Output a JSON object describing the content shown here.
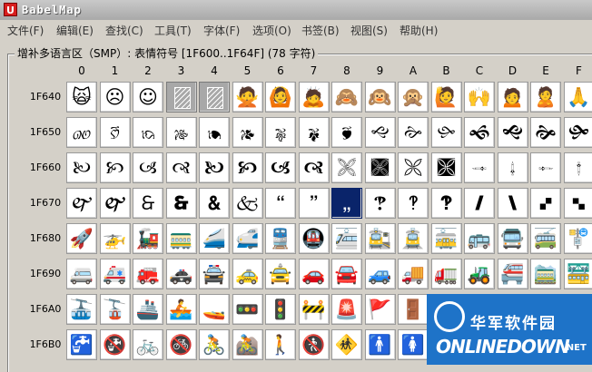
{
  "window": {
    "title": "BabelMap",
    "app_icon_letter": "U"
  },
  "menu": [
    {
      "label": "文件(F)"
    },
    {
      "label": "编辑(E)"
    },
    {
      "label": "查找(C)"
    },
    {
      "label": "工具(T)"
    },
    {
      "label": "字体(F)"
    },
    {
      "label": "选项(O)"
    },
    {
      "label": "书签(B)"
    },
    {
      "label": "视图(S)"
    },
    {
      "label": "帮助(H)"
    }
  ],
  "group": {
    "title": "增补多语言区（SMP）: 表情符号 [1F600..1F64F] (78 字符)"
  },
  "columns": [
    "0",
    "1",
    "2",
    "3",
    "4",
    "5",
    "6",
    "7",
    "8",
    "9",
    "A",
    "B",
    "C",
    "D",
    "E",
    "F"
  ],
  "rows": [
    {
      "label": "1F640",
      "cells": [
        "🙀",
        "☹",
        "☺",
        "",
        "",
        "🙅",
        "🙆",
        "🙇",
        "🙈",
        "🙉",
        "🙊",
        "🙋",
        "🙌",
        "🙍",
        "🙎",
        "🙏"
      ]
    },
    {
      "label": "1F650",
      "cells": [
        "🙐",
        "🙑",
        "🙒",
        "🙓",
        "🙔",
        "🙕",
        "🙖",
        "🙗",
        "🙘",
        "🙙",
        "🙚",
        "🙛",
        "🙜",
        "🙝",
        "🙞",
        "🙟"
      ]
    },
    {
      "label": "1F660",
      "cells": [
        "🙠",
        "🙡",
        "🙢",
        "🙣",
        "🙤",
        "🙥",
        "🙦",
        "🙧",
        "🙨",
        "🙩",
        "🙪",
        "🙫",
        "🙬",
        "🙭",
        "🙮",
        "🙯"
      ]
    },
    {
      "label": "1F670",
      "cells": [
        "🙰",
        "🙱",
        "🙲",
        "🙳",
        "🙴",
        "🙵",
        "🙶",
        "🙷",
        "🙸",
        "🙹",
        "🙺",
        "🙻",
        "🙼",
        "🙽",
        "🙾",
        "🙿"
      ]
    },
    {
      "label": "1F680",
      "cells": [
        "🚀",
        "🚁",
        "🚂",
        "🚃",
        "🚄",
        "🚅",
        "🚆",
        "🚇",
        "🚈",
        "🚉",
        "🚊",
        "🚋",
        "🚌",
        "🚍",
        "🚎",
        "🚏"
      ]
    },
    {
      "label": "1F690",
      "cells": [
        "🚐",
        "🚑",
        "🚒",
        "🚓",
        "🚔",
        "🚕",
        "🚖",
        "🚗",
        "🚘",
        "🚙",
        "🚚",
        "🚛",
        "🚜",
        "🚝",
        "🚞",
        "🚟"
      ]
    },
    {
      "label": "1F6A0",
      "cells": [
        "🚠",
        "🚡",
        "🚢",
        "🚣",
        "🚤",
        "🚥",
        "🚦",
        "🚧",
        "🚨",
        "🚩",
        "🚪",
        "",
        "",
        "",
        "",
        ""
      ]
    },
    {
      "label": "1F6B0",
      "cells": [
        "🚰",
        "🚱",
        "🚲",
        "🚳",
        "🚴",
        "🚵",
        "🚶",
        "🚷",
        "🚸",
        "🚹",
        "🚺",
        "",
        "",
        "",
        "",
        ""
      ]
    }
  ],
  "cell_state": {
    "unassigned": [
      [
        0,
        3
      ],
      [
        0,
        4
      ]
    ],
    "selected": [
      3,
      8
    ],
    "empty": [
      [
        6,
        11
      ],
      [
        6,
        12
      ],
      [
        6,
        13
      ],
      [
        6,
        14
      ],
      [
        6,
        15
      ],
      [
        7,
        11
      ],
      [
        7,
        12
      ],
      [
        7,
        13
      ],
      [
        7,
        14
      ],
      [
        7,
        15
      ]
    ]
  },
  "watermark": {
    "top": "华军软件园",
    "main": "ONLINEDOWN",
    "suffix": ".NET",
    "accent": "#1e73c8"
  }
}
